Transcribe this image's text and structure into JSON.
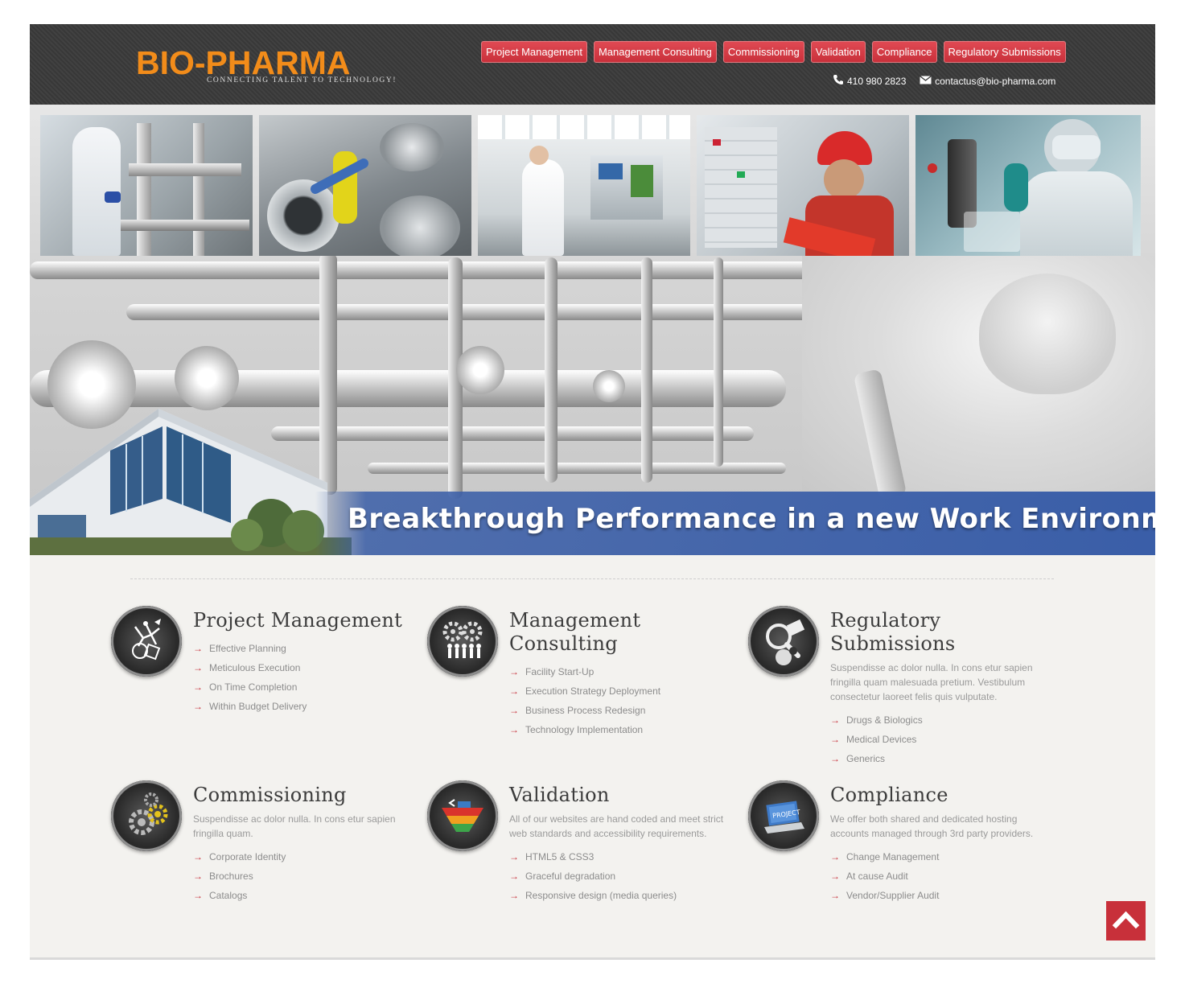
{
  "header": {
    "logo_text": "BIO-PHARMA",
    "logo_tagline": "CONNECTING TALENT TO TECHNOLOGY!",
    "nav": [
      {
        "label": "Project Management"
      },
      {
        "label": "Management Consulting"
      },
      {
        "label": "Commissioning"
      },
      {
        "label": "Validation"
      },
      {
        "label": "Compliance"
      },
      {
        "label": "Regulatory Submissions"
      }
    ],
    "phone": "410 980 2823",
    "email": "contactus@bio-pharma.com",
    "phone_icon": "phone-icon",
    "email_icon": "envelope-icon"
  },
  "hero": {
    "banner_text": "Breakthrough Performance in a new Work Environment"
  },
  "services": [
    {
      "title": "Project Management",
      "icon": "project-management-icon",
      "items": [
        "Effective Planning",
        "Meticulous Execution",
        "On Time Completion",
        "Within Budget Delivery"
      ]
    },
    {
      "title": "Management Consulting",
      "icon": "gears-people-icon",
      "items": [
        "Facility Start-Up",
        "Execution Strategy Deployment",
        "Business Process Redesign",
        "Technology Implementation"
      ]
    },
    {
      "title": "Regulatory Submissions",
      "icon": "magnifier-document-icon",
      "description": "Suspendisse ac dolor nulla. In cons etur sapien fringilla quam malesuada pretium. Vestibulum consectetur laoreet felis quis vulputate.",
      "items": [
        "Drugs & Biologics",
        "Medical Devices",
        "Generics"
      ]
    },
    {
      "title": "Commissioning",
      "icon": "gears-icon",
      "description": "Suspendisse ac dolor nulla. In cons etur sapien fringilla quam.",
      "items": [
        "Corporate Identity",
        "Brochures",
        "Catalogs"
      ]
    },
    {
      "title": "Validation",
      "icon": "process-diagram-icon",
      "description": "All of our websites are hand coded and meet strict web standards and accessibility requirements.",
      "items": [
        "HTML5 & CSS3",
        "Graceful degradation",
        "Responsive design (media queries)"
      ]
    },
    {
      "title": "Compliance",
      "icon": "project-laptop-icon",
      "description": "We offer both shared and dedicated hosting accounts managed through 3rd party providers.",
      "items": [
        "Change Management",
        "At cause Audit",
        "Vendor/Supplier Audit"
      ]
    }
  ],
  "colors": {
    "accent": "#c8303a",
    "header_bg": "#3b3b3b",
    "logo_orange": "#f28c1a",
    "banner_blue": "#3a5ea8"
  },
  "scroll_top_icon": "chevron-up-icon"
}
